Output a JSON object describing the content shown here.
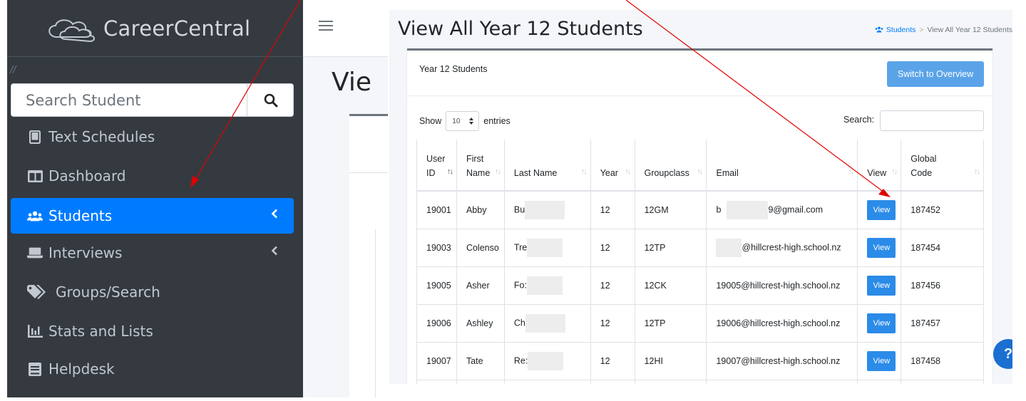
{
  "sidebar": {
    "brand_name": "CareerCentral",
    "slash_mark": "//",
    "search_placeholder": "Search Student",
    "items": [
      {
        "label": "Text Schedules",
        "icon": "tablet-icon"
      },
      {
        "label": "Dashboard",
        "icon": "columns-icon"
      },
      {
        "label": "Students",
        "icon": "users-icon",
        "active": true
      },
      {
        "label": "Interviews",
        "icon": "laptop-icon"
      },
      {
        "label": "Groups/Search",
        "icon": "tags-icon"
      },
      {
        "label": "Stats and Lists",
        "icon": "chart-bar-icon"
      },
      {
        "label": "Helpdesk",
        "icon": "book-icon"
      }
    ],
    "active_color": "#007bff",
    "background": "#343a40"
  },
  "background_page": {
    "heading_partial": "Vie"
  },
  "main": {
    "title": "View All Year 12 Students",
    "breadcrumb": {
      "link": "Students",
      "separator": ">",
      "current": "View All Year 12 Students"
    },
    "card_title": "Year 12 Students",
    "switch_button": "Switch to Overview",
    "show_label": "Show",
    "entries_value": "10",
    "entries_label": "entries",
    "search_label": "Search:",
    "columns": [
      "User ID",
      "First Name",
      "Last Name",
      "Year",
      "Groupclass",
      "Email",
      "View",
      "Global Code"
    ],
    "view_button_label": "View",
    "rows": [
      {
        "user_id": "19001",
        "first_name": "Abby",
        "last_name": "Bu",
        "year": "12",
        "groupclass": "12GM",
        "email_start": "b",
        "email_end": "9@gmail.com",
        "global_code": "187452"
      },
      {
        "user_id": "19003",
        "first_name": "Colenso",
        "last_name": "Tre",
        "year": "12",
        "groupclass": "12TP",
        "email_start": "",
        "email_end": "@hillcrest-high.school.nz",
        "global_code": "187454"
      },
      {
        "user_id": "19005",
        "first_name": "Asher",
        "last_name": "Fo:",
        "year": "12",
        "groupclass": "12CK",
        "email_start": "19005@hillcrest-high.school.nz",
        "email_end": "",
        "global_code": "187456"
      },
      {
        "user_id": "19006",
        "first_name": "Ashley",
        "last_name": "Ch",
        "year": "12",
        "groupclass": "12TP",
        "email_start": "19006@hillcrest-high.school.nz",
        "email_end": "",
        "global_code": "187457"
      },
      {
        "user_id": "19007",
        "first_name": "Tate",
        "last_name": "Re:",
        "year": "12",
        "groupclass": "12HI",
        "email_start": "19007@hillcrest-high.school.nz",
        "email_end": "",
        "global_code": "187458"
      }
    ],
    "help_label": "?",
    "button_color": "#2b8be8"
  },
  "annotations": {
    "arrow_color": "#e00000"
  }
}
